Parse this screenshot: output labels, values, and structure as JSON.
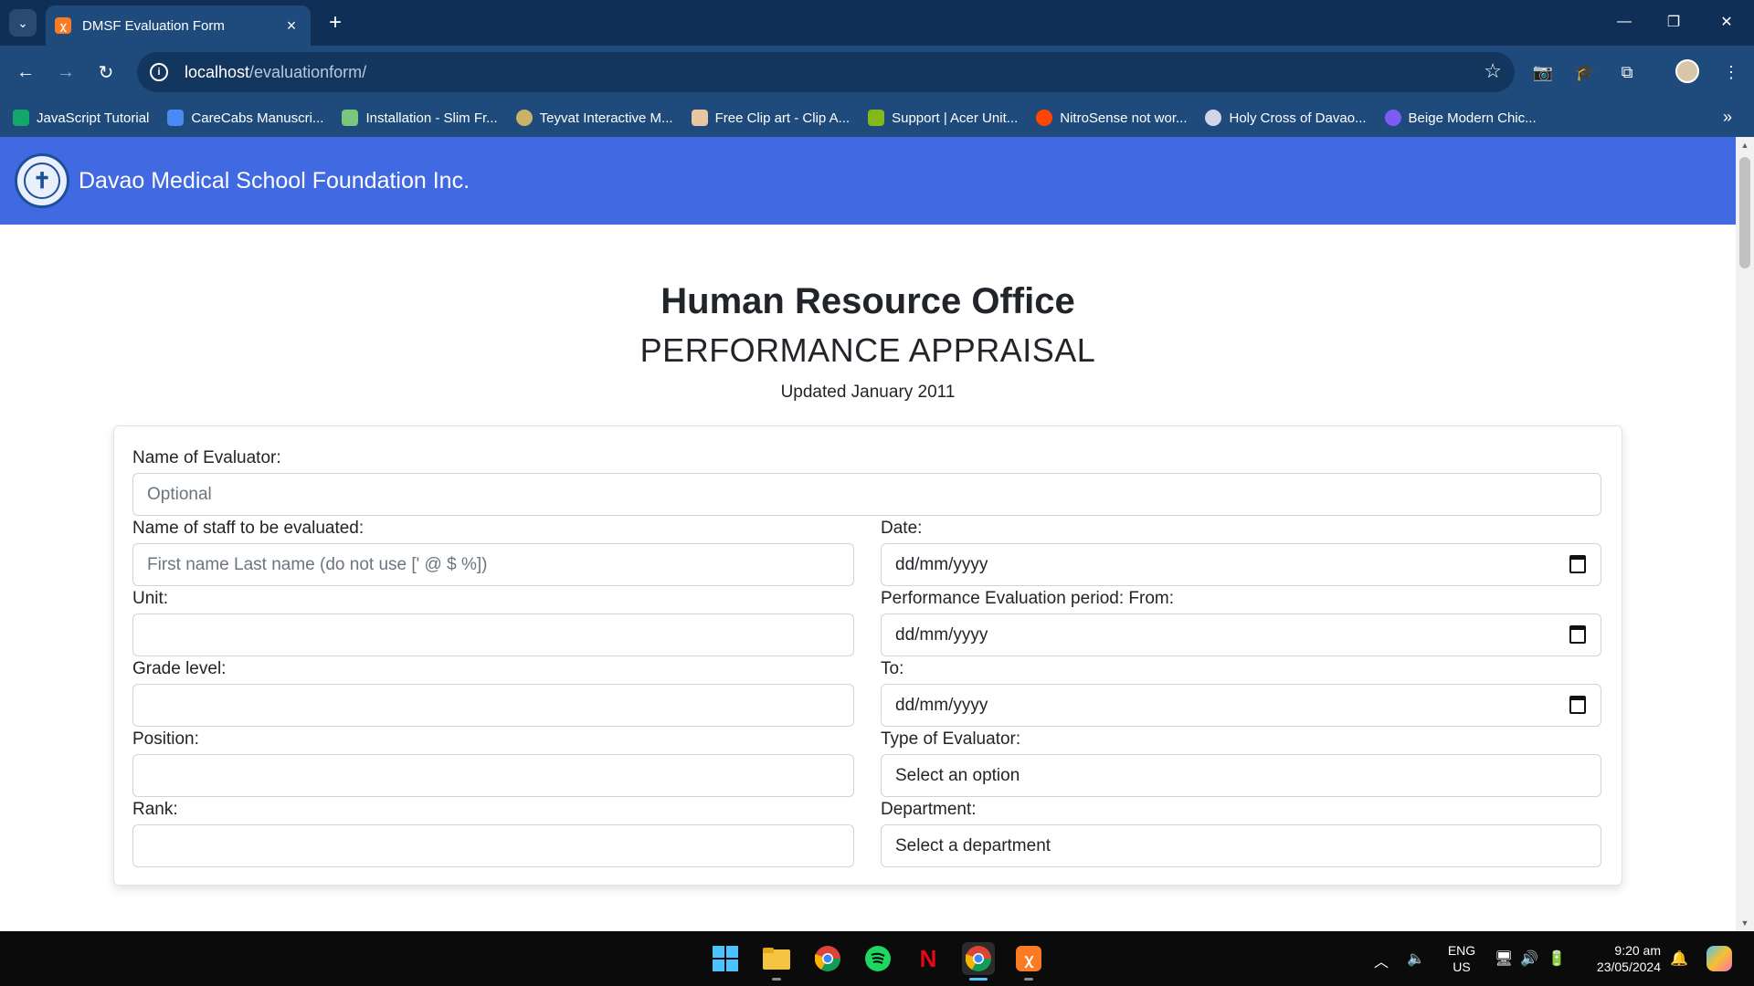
{
  "browser": {
    "tab_title": "DMSF Evaluation Form",
    "url_host": "localhost",
    "url_path": "/evaluationform/",
    "bookmarks": [
      {
        "label": "JavaScript Tutorial",
        "color": "#14a76c"
      },
      {
        "label": "CareCabs Manuscri...",
        "color": "#4a8af4"
      },
      {
        "label": "Installation - Slim Fr...",
        "color": "#7bc67b"
      },
      {
        "label": "Teyvat Interactive M...",
        "color": "#c9b36b"
      },
      {
        "label": "Free Clip art - Clip A...",
        "color": "#e8c8a0"
      },
      {
        "label": "Support | Acer Unit...",
        "color": "#83b81a"
      },
      {
        "label": "NitroSense not wor...",
        "color": "#ff4500"
      },
      {
        "label": "Holy Cross of Davao...",
        "color": "#d0d6e6"
      },
      {
        "label": "Beige Modern Chic...",
        "color": "#7d5cf5"
      }
    ]
  },
  "header": {
    "site_title": "Davao Medical School Foundation Inc.",
    "logo_color": "#1d4f9a",
    "bg_color": "#4169e1"
  },
  "page": {
    "office": "Human Resource Office",
    "title": "PERFORMANCE APPRAISAL",
    "updated": "Updated January 2011"
  },
  "form": {
    "evaluator_label": "Name of Evaluator:",
    "evaluator_placeholder": "Optional",
    "staff_label": "Name of staff to be evaluated:",
    "staff_placeholder": "First name Last name (do not use [' @ $ %])",
    "date_label": "Date:",
    "date_value": "dd/mm/yyyy",
    "unit_label": "Unit:",
    "period_from_label": "Performance Evaluation period: From:",
    "period_from_value": "dd/mm/yyyy",
    "grade_label": "Grade level:",
    "to_label": "To:",
    "to_value": "dd/mm/yyyy",
    "position_label": "Position:",
    "evaluator_type_label": "Type of Evaluator:",
    "evaluator_type_value": "Select an option",
    "rank_label": "Rank:",
    "department_label": "Department:",
    "department_value": "Select a department"
  },
  "taskbar": {
    "lang": "ENG",
    "region": "US",
    "time": "9:20 am",
    "date": "23/05/2024"
  }
}
